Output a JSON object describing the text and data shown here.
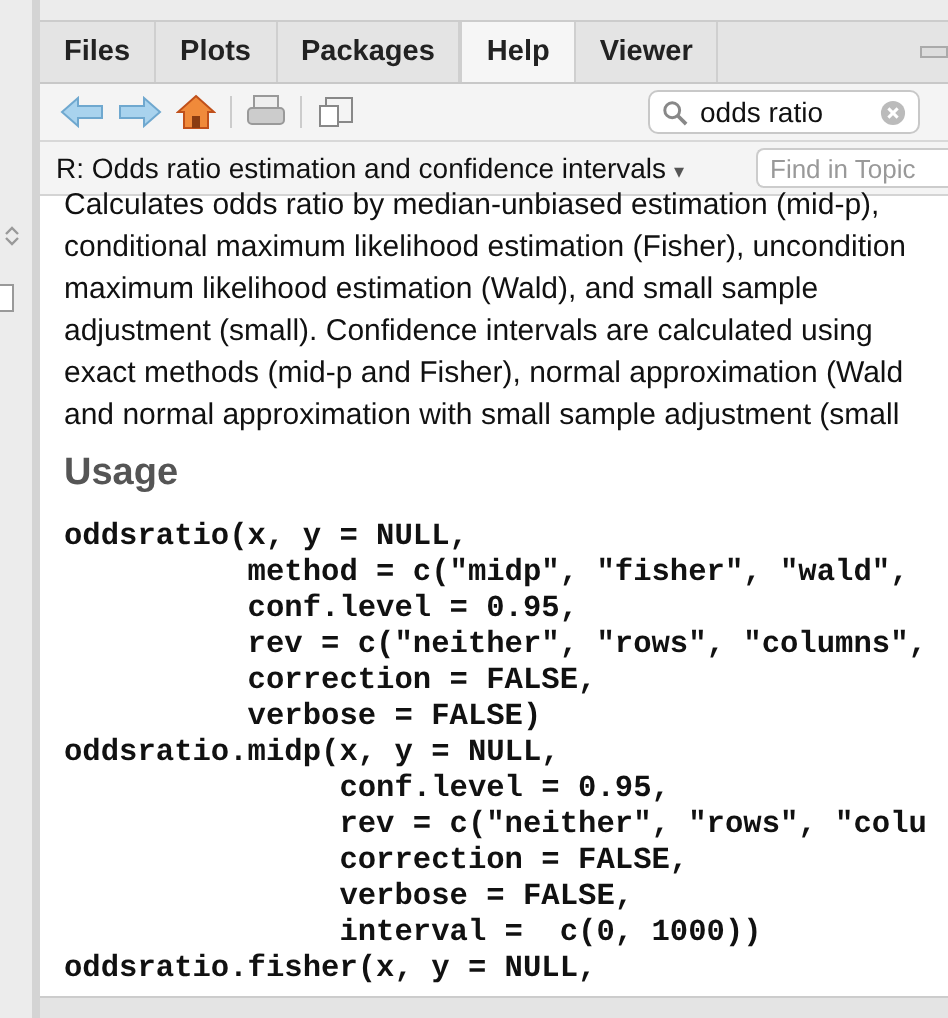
{
  "tabs": [
    {
      "label": "Files",
      "selected": false
    },
    {
      "label": "Plots",
      "selected": false
    },
    {
      "label": "Packages",
      "selected": false
    },
    {
      "label": "Help",
      "selected": true
    },
    {
      "label": "Viewer",
      "selected": false
    }
  ],
  "toolbar": {
    "search": {
      "value": "odds ratio"
    }
  },
  "topic_bar": {
    "title": "R: Odds ratio estimation and confidence intervals",
    "caret": "▾",
    "find": {
      "placeholder": "Find in Topic"
    }
  },
  "description": [
    "Calculates odds ratio by median-unbiased estimation (mid-p),",
    "conditional maximum likelihood estimation (Fisher), uncondition",
    "maximum likelihood estimation (Wald), and small sample",
    "adjustment (small). Confidence intervals are calculated using",
    "exact methods (mid-p and Fisher), normal approximation (Wald",
    "and normal approximation with small sample adjustment (small"
  ],
  "usage": {
    "heading": "Usage",
    "code": [
      "oddsratio(x, y = NULL,",
      "          method = c(\"midp\", \"fisher\", \"wald\",",
      "          conf.level = 0.95,",
      "          rev = c(\"neither\", \"rows\", \"columns\",",
      "          correction = FALSE,",
      "          verbose = FALSE)",
      "oddsratio.midp(x, y = NULL,",
      "               conf.level = 0.95,",
      "               rev = c(\"neither\", \"rows\", \"colu",
      "               correction = FALSE,",
      "               verbose = FALSE,",
      "               interval =  c(0, 1000))",
      "oddsratio.fisher(x, y = NULL,"
    ]
  }
}
